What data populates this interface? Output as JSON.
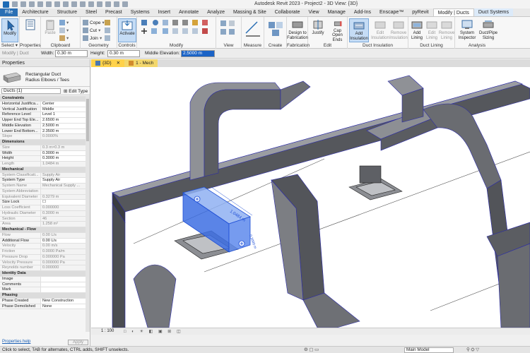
{
  "title": "Autodesk Revit 2023 - Project2 - 3D View: {3D}",
  "tabs": [
    "File",
    "Architecture",
    "Structure",
    "Steel",
    "Precast",
    "Systems",
    "Insert",
    "Annotate",
    "Analyze",
    "Massing & Site",
    "Collaborate",
    "View",
    "Manage",
    "Add-Ins",
    "Enscape™",
    "pyRevit",
    "Modify | Ducts",
    "Duct Systems"
  ],
  "ribbon": {
    "modify": "Modify",
    "select": "Select",
    "properties": "Properties",
    "clipboard": "Clipboard",
    "paste": "Paste",
    "cope": "Cope",
    "cut": "Cut",
    "join": "Join",
    "geometry": "Geometry",
    "activate": "Activate",
    "controls": "Controls",
    "modify_group": "Modify",
    "view": "View",
    "measure": "Measure",
    "create": "Create",
    "design_to_fabrication": "Design to Fabrication",
    "justify": "Justify",
    "cap_open_ends": "Cap Open Ends",
    "fabrication": "Fabrication",
    "edit": "Edit",
    "add_insulation": "Add Insulation",
    "edit_insulation": "Edit Insulation",
    "remove_insulation": "Remove Insulation",
    "duct_insulation": "Duct Insulation",
    "add_lining": "Add Lining",
    "edit_lining": "Edit Lining",
    "remove_lining": "Remove Lining",
    "duct_lining": "Duct Lining",
    "system_inspector": "System Inspector",
    "duct_pipe_sizing": "Duct/Pipe Sizing",
    "analysis": "Analysis"
  },
  "options": {
    "modify_ducts": "Modify | Duct",
    "width_label": "Width:",
    "width_value": "0.30 m",
    "height_label": "Height:",
    "height_value": "0.30 m",
    "middle_elev_label": "Middle Elevation:",
    "middle_elev_value": "2.5000 m"
  },
  "properties": {
    "title": "Properties",
    "type_name": "Rectangular Duct",
    "type_sub": "Radius Elbows / Tees",
    "instance": "Ducts (1)",
    "edit_type": "Edit Type",
    "help": "Properties help",
    "apply": "Apply",
    "rows": [
      {
        "h": true,
        "k": "Constraints"
      },
      {
        "k": "Horizontal Justifica...",
        "v": "Center"
      },
      {
        "k": "Vertical Justification",
        "v": "Middle"
      },
      {
        "k": "Reference Level",
        "v": "Level 1"
      },
      {
        "k": "Upper End Top Ele...",
        "v": "2.6500 m"
      },
      {
        "k": "Middle Elevation",
        "v": "2.5000 m"
      },
      {
        "k": "Lower End Bottom...",
        "v": "2.3500 m"
      },
      {
        "k": "Slope",
        "v": "0.0000%",
        "g": true
      },
      {
        "h": true,
        "k": "Dimensions"
      },
      {
        "k": "Size",
        "v": "0.3 m×0.3 m",
        "g": true
      },
      {
        "k": "Width",
        "v": "0.3000 m"
      },
      {
        "k": "Height",
        "v": "0.3000 m"
      },
      {
        "k": "Length",
        "v": "1.0484 m",
        "g": true
      },
      {
        "h": true,
        "k": "Mechanical"
      },
      {
        "k": "System Classificati...",
        "v": "Supply Air",
        "g": true
      },
      {
        "k": "System Type",
        "v": "Supply Air"
      },
      {
        "k": "System Name",
        "v": "Mechanical Supply ...",
        "g": true
      },
      {
        "k": "System Abbreviation",
        "v": "",
        "g": true
      },
      {
        "k": "Equivalent Diameter",
        "v": "0.3279 m",
        "g": true
      },
      {
        "k": "Size Lock",
        "v": "☐"
      },
      {
        "k": "Loss Coefficient",
        "v": "0.000000",
        "g": true
      },
      {
        "k": "Hydraulic Diameter",
        "v": "0.3000 m",
        "g": true
      },
      {
        "k": "Section",
        "v": "46",
        "g": true
      },
      {
        "k": "Area",
        "v": "1.258 m²",
        "g": true
      },
      {
        "h": true,
        "k": "Mechanical - Flow"
      },
      {
        "k": "Flow",
        "v": "0.00 L/s",
        "g": true
      },
      {
        "k": "Additional Flow",
        "v": "0.00 L/s"
      },
      {
        "k": "Velocity",
        "v": "0.00 m/s",
        "g": true
      },
      {
        "k": "Friction",
        "v": "0.0000 Pa/m",
        "g": true
      },
      {
        "k": "Pressure Drop",
        "v": "0.000000 Pa",
        "g": true
      },
      {
        "k": "Velocity Pressure",
        "v": "0.000000 Pa",
        "g": true
      },
      {
        "k": "Reynolds number",
        "v": "0.000000",
        "g": true
      },
      {
        "h": true,
        "k": "Identity Data"
      },
      {
        "k": "Image",
        "v": ""
      },
      {
        "k": "Comments",
        "v": ""
      },
      {
        "k": "Mark",
        "v": ""
      },
      {
        "h": true,
        "k": "Phasing"
      },
      {
        "k": "Phase Created",
        "v": "New Construction"
      },
      {
        "k": "Phase Demolished",
        "v": "None"
      }
    ]
  },
  "views": {
    "tab1": "{3D}",
    "tab2": "1 - Mech"
  },
  "canvas": {
    "dim_length": "1.0484 m",
    "dim_small": "0.3000 m"
  },
  "viewbar": {
    "scale": "1 : 100"
  },
  "status": {
    "message": "Click to select, TAB for alternates, CTRL adds, SHIFT unselects.",
    "model": "Main Model"
  },
  "colors": {
    "accent": "#2a6fb4",
    "selection": "#3b6fe6",
    "duct": "#707379"
  }
}
